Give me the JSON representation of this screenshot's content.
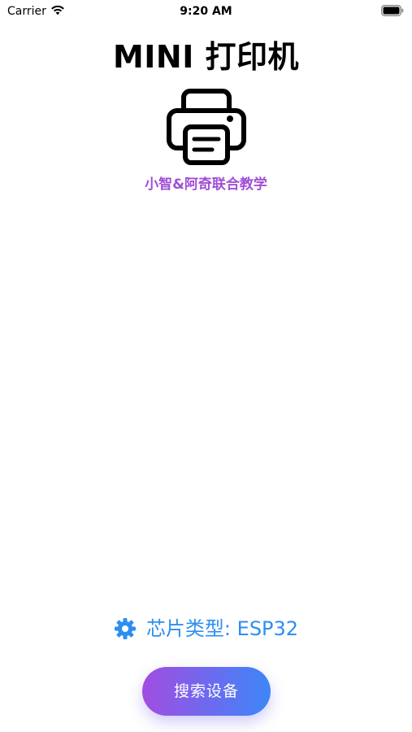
{
  "status_bar": {
    "carrier": "Carrier",
    "time": "9:20 AM"
  },
  "header": {
    "title": "MINI 打印机",
    "icon": "printer-icon",
    "subtitle": "小智&阿奇联合教学"
  },
  "chip": {
    "icon": "gear-icon",
    "label": "芯片类型: ESP32"
  },
  "actions": {
    "search_label": "搜索设备"
  },
  "colors": {
    "subtitle": "#a24fd6",
    "accent_blue": "#2d8ef0",
    "button_gradient_start": "#a24de0",
    "button_gradient_end": "#3d86f7"
  }
}
